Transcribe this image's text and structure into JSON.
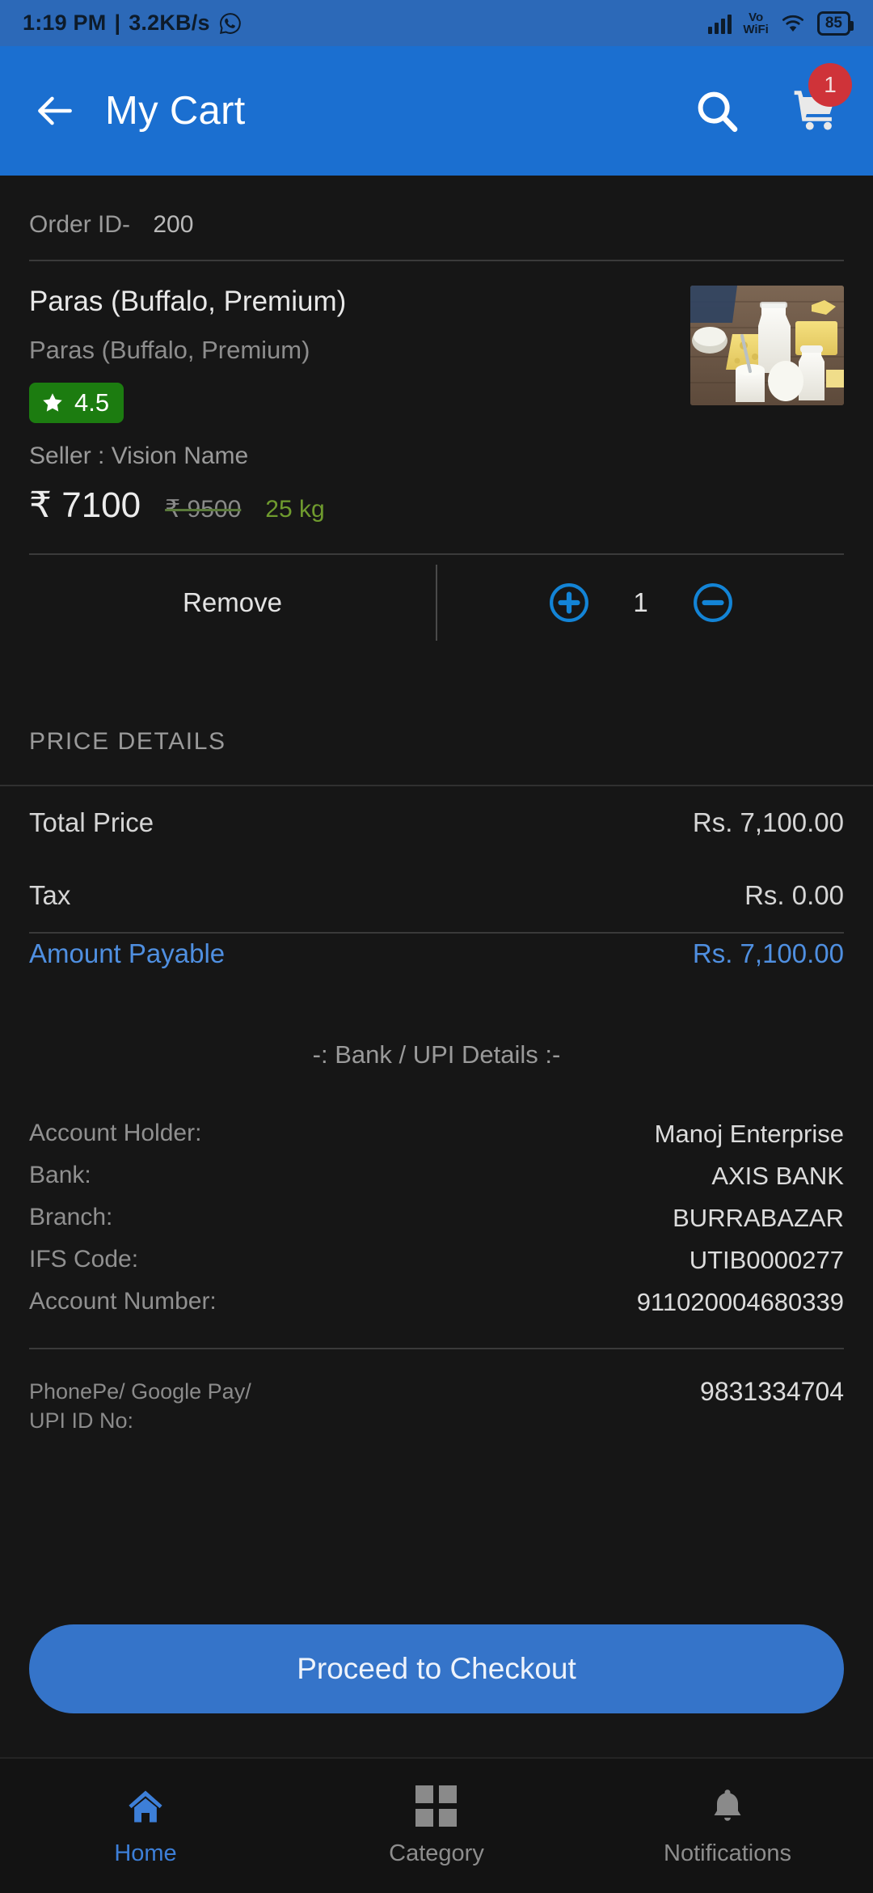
{
  "statusbar": {
    "time": "1:19 PM",
    "separator": "|",
    "network_speed": "3.2KB/s",
    "whatsapp_icon": "whatsapp-icon",
    "signal_icon": "signal-bars-icon",
    "vo_line1": "Vo",
    "vo_line2": "WiFi",
    "wifi_icon": "wifi-icon",
    "battery_level": "85"
  },
  "appbar": {
    "back_icon": "back-arrow-icon",
    "title": "My Cart",
    "search_icon": "search-icon",
    "cart_icon": "shopping-cart-icon",
    "cart_badge": "1",
    "bg_color": "#1b6fd0",
    "badge_color": "#cf3339"
  },
  "order": {
    "id_label": "Order ID-",
    "id_value": "200"
  },
  "product": {
    "title": "Paras (Buffalo, Premium)",
    "subtitle": "Paras (Buffalo, Premium)",
    "rating": "4.5",
    "rating_star_icon": "star-icon",
    "rating_color": "#1c7c10",
    "seller": "Seller : Vision Name",
    "price": "₹ 7100",
    "mrp": "₹ 9500",
    "weight": "25 kg",
    "weight_color": "#6f9b2e",
    "thumbnail": "dairy-products-photo",
    "remove_label": "Remove",
    "increase_icon": "plus-circle-icon",
    "decrease_icon": "minus-circle-icon",
    "quantity": "1"
  },
  "price_details": {
    "heading": "PRICE DETAILS",
    "rows": [
      {
        "label": "Total Price",
        "value": "Rs.  7,100.00"
      },
      {
        "label": "Tax",
        "value": "Rs. 0.00"
      }
    ],
    "total": {
      "label": "Amount Payable",
      "value": "Rs.  7,100.00",
      "color": "#4f8fe0"
    }
  },
  "bank": {
    "heading": "-: Bank / UPI Details :-",
    "rows": [
      {
        "label": "Account Holder:",
        "value": "Manoj Enterprise"
      },
      {
        "label": "Bank:",
        "value": "AXIS BANK"
      },
      {
        "label": "Branch:",
        "value": "BURRABAZAR"
      },
      {
        "label": "IFS Code:",
        "value": "UTIB0000277"
      },
      {
        "label": "Account Number:",
        "value": "911020004680339"
      }
    ],
    "upi_label_line1": "PhonePe/ Google Pay/",
    "upi_label_line2": "UPI ID No:",
    "upi_value": "9831334704"
  },
  "checkout": {
    "label": "Proceed to Checkout",
    "color": "#3574c9"
  },
  "bottomnav": {
    "items": [
      {
        "label": "Home",
        "icon": "home-icon",
        "active": true
      },
      {
        "label": "Category",
        "icon": "grid-icon",
        "active": false
      },
      {
        "label": "Notifications",
        "icon": "bell-icon",
        "active": false
      }
    ],
    "active_color": "#3d7fd8"
  }
}
